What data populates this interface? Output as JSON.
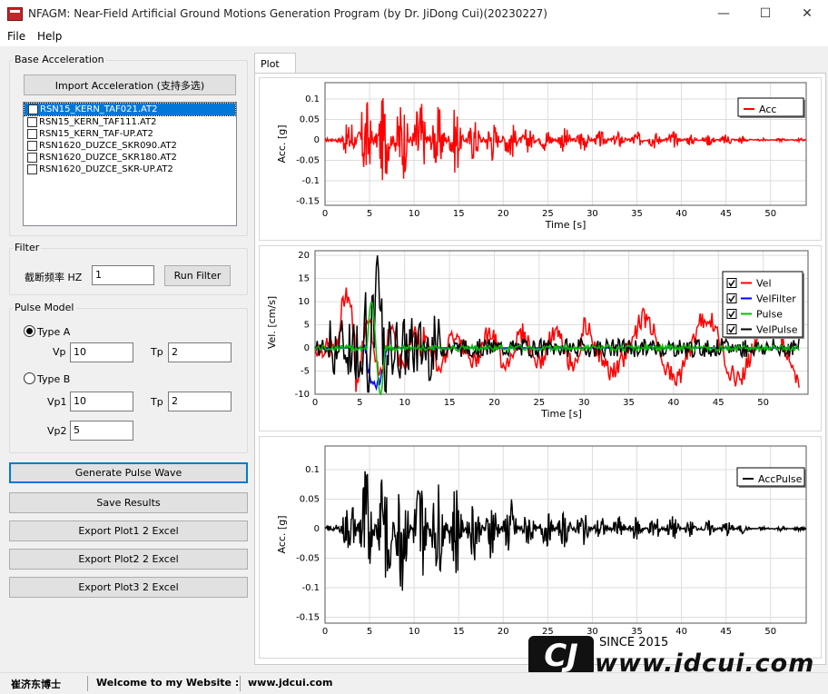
{
  "window": {
    "title": "NFAGM: Near-Field Artificial Ground Motions Generation Program (by Dr. JiDong Cui)(20230227)",
    "minimize": "—",
    "maximize": "☐",
    "close": "✕"
  },
  "menu": {
    "file": "File",
    "help": "Help"
  },
  "base": {
    "label": "Base Acceleration",
    "import_btn": "Import Acceleration (支持多选)",
    "files": [
      "RSN15_KERN_TAF021.AT2",
      "RSN15_KERN_TAF111.AT2",
      "RSN15_KERN_TAF-UP.AT2",
      "RSN1620_DUZCE_SKR090.AT2",
      "RSN1620_DUZCE_SKR180.AT2",
      "RSN1620_DUZCE_SKR-UP.AT2"
    ]
  },
  "filter": {
    "label": "Filter",
    "cutoff_label": "截断频率 HZ",
    "cutoff_value": "1",
    "run_btn": "Run Filter"
  },
  "pulse": {
    "label": "Pulse Model",
    "type_a": "Type A",
    "type_b": "Type B",
    "vp_label": "Vp",
    "vp_value": "10",
    "tp_label": "Tp",
    "tp_value": "2",
    "vp1_label": "Vp1",
    "vp1_value": "10",
    "tp_b_label": "Tp",
    "tp_b_value": "2",
    "vp2_label": "Vp2",
    "vp2_value": "5"
  },
  "actions": {
    "generate": "Generate Pulse Wave",
    "save": "Save Results",
    "export1": "Export Plot1 2 Excel",
    "export2": "Export Plot2 2 Excel",
    "export3": "Export Plot3 2 Excel"
  },
  "tab": {
    "plot": "Plot"
  },
  "chart_data": [
    {
      "type": "line",
      "xlabel": "Time [s]",
      "ylabel": "Acc. [g]",
      "xlim": [
        0,
        54
      ],
      "ylim": [
        -0.16,
        0.14
      ],
      "xticks": [
        "0",
        "5",
        "10",
        "15",
        "20",
        "25",
        "30",
        "35",
        "40",
        "45",
        "50"
      ],
      "yticks": [
        "0.1",
        "0.05",
        "0",
        "-0.05",
        "-0.1",
        "-0.15"
      ],
      "legend_position": "top-right",
      "series": [
        {
          "name": "Acc",
          "color": "#ff0000"
        }
      ]
    },
    {
      "type": "line",
      "xlabel": "Time [s]",
      "ylabel": "Vel. [cm/s]",
      "xlim": [
        0,
        55
      ],
      "ylim": [
        -10,
        21
      ],
      "xticks": [
        "0",
        "5",
        "10",
        "15",
        "20",
        "25",
        "30",
        "35",
        "40",
        "45",
        "50"
      ],
      "yticks": [
        "20",
        "15",
        "10",
        "5",
        "0",
        "-5",
        "-10"
      ],
      "legend_position": "top-right",
      "series": [
        {
          "name": "Vel",
          "color": "#ff0000"
        },
        {
          "name": "VelFilter",
          "color": "#0000ff"
        },
        {
          "name": "Pulse",
          "color": "#00c000"
        },
        {
          "name": "VelPulse",
          "color": "#000000"
        }
      ]
    },
    {
      "type": "line",
      "xlabel": "Time [s]",
      "ylabel": "Acc. [g]",
      "xlim": [
        0,
        54
      ],
      "ylim": [
        -0.16,
        0.14
      ],
      "xticks": [
        "0",
        "5",
        "10",
        "15",
        "20",
        "25",
        "30",
        "35",
        "40",
        "45",
        "50"
      ],
      "yticks": [
        "0.1",
        "0.05",
        "0",
        "-0.05",
        "-0.1",
        "-0.15"
      ],
      "legend_position": "top-right",
      "series": [
        {
          "name": "AccPulse",
          "color": "#000000"
        }
      ]
    }
  ],
  "status": {
    "author": "崔济东博士",
    "welcome": "Welcome to my Website :",
    "url": "www.jdcui.com"
  },
  "watermark": {
    "since": "SINCE 2015",
    "site": "www.jdcui.com"
  }
}
